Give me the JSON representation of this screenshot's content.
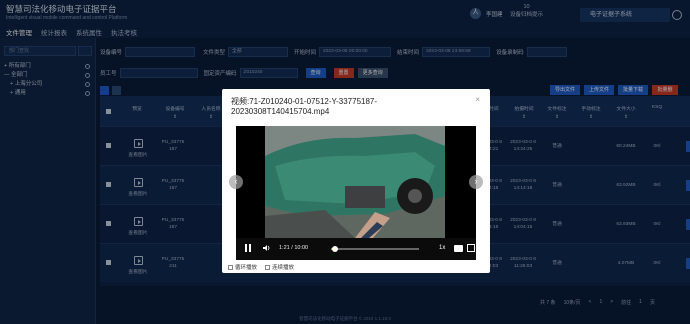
{
  "header": {
    "title": "智慧司法化移动电子证据平台",
    "subtitle": "Intelligent visual mobile command and control Platform",
    "menu": [
      {
        "label": "文件管理",
        "active": true
      },
      {
        "label": "统计报表",
        "active": false
      },
      {
        "label": "系统属性",
        "active": false
      },
      {
        "label": "执法考核",
        "active": false
      }
    ],
    "username": "李国建",
    "notice": [
      "10",
      "设备归档提示"
    ],
    "dept": "电子证据子系统",
    "avatar_text": "人"
  },
  "sidebar": {
    "search_placeholder": "部门查找",
    "tree": [
      {
        "label": "+ 所有部门"
      },
      {
        "label": "— 全部门"
      },
      {
        "label": "+ 上海分公司"
      },
      {
        "label": "+ 通用"
      }
    ]
  },
  "filters": {
    "device_no_label": "设备编号",
    "file_type_label": "文件类型",
    "file_type_value": "全部",
    "start_time_label": "开始时间",
    "start_time_value": "2023-03-06 00:00:00",
    "end_time_label": "结束时间",
    "end_time_value": "2023-03-08 23:59:59",
    "recorder_label": "设备录制码",
    "officer_label": "员工号",
    "asset_label": "固定资产编码",
    "asset_value": "Z010240",
    "query_btn": "查询",
    "reset_btn": "重置",
    "more_btn": "更多查询",
    "export_btn": "导出文件",
    "upload_btn": "上传文件",
    "batch_download_btn": "批量下载",
    "batch_delete_btn": "批量删除"
  },
  "table": {
    "headers": [
      {
        "title": "预览",
        "sort": ""
      },
      {
        "title": "设备编号",
        "sort": "⇕"
      },
      {
        "title": "人员名称",
        "sort": "⇕"
      },
      {
        "title": "上传时间",
        "sort": "⇕"
      },
      {
        "title": "拍摄时间",
        "sort": "⇕"
      },
      {
        "title": "文件标注",
        "sort": "⇕"
      },
      {
        "title": "手动标注",
        "sort": "⇕"
      },
      {
        "title": "文件大小",
        "sort": "⇕"
      },
      {
        "title": "KSQ",
        "sort": "⇕"
      }
    ],
    "preview_label": "查看图片",
    "rows": [
      {
        "device": "PU_33775 187",
        "upload": "2023-03-0 8 14:24:21",
        "shoot": "2023-03-0 8 14:24:25",
        "tag": "普通",
        "size": "60.24MB",
        "ksq": "0Kl"
      },
      {
        "device": "PU_33775 187",
        "upload": "2023-03-0 8 14:14:18",
        "shoot": "2023-03-0 8 14:14:18",
        "tag": "普通",
        "size": "63.92MB",
        "ksq": "0Kl"
      },
      {
        "device": "PU_33775 187",
        "upload": "2023-03-0 8 14:04:15",
        "shoot": "2023-03-0 8 14:04:15",
        "tag": "普通",
        "size": "63.93MB",
        "ksq": "0Kl"
      },
      {
        "device": "PU_33775 211",
        "upload": "2023-03-0 8 11:26:03",
        "shoot": "2023-03-0 8 11:26:03",
        "tag": "普通",
        "size": "4.07MB",
        "ksq": "0Kl"
      }
    ]
  },
  "pager": {
    "total": "共 7 条",
    "per_page": "10条/页",
    "prev": "<",
    "page": "1",
    "next": ">",
    "goto": "前往",
    "goto_page": "1",
    "page_unit": "页"
  },
  "footer": "智慧司法化移动电子证据平台 © 2019 1.1.16.0",
  "modal": {
    "title": "视频:71-Z010240-01-07512-Y-33775187-20230308T140415704.mp4",
    "close": "×",
    "time_current": "1:21",
    "time_total": "10:00",
    "progress": 0.04,
    "speed": "1x",
    "loop_label": "循环播放",
    "continuous_label": "连续播放"
  }
}
